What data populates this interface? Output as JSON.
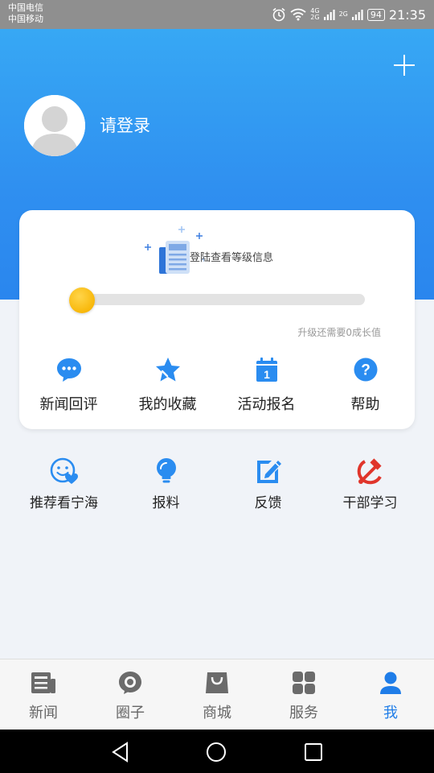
{
  "status_bar": {
    "carrier1": "中国电信",
    "carrier2": "中国移动",
    "net1": "4G",
    "net1b": "2G",
    "net2": "2G",
    "battery": "94",
    "time": "21:35"
  },
  "header": {
    "login_text": "请登录"
  },
  "level_card": {
    "info_text": "登陆查看等级信息",
    "progress": 0,
    "upgrade_text": "升级还需要0成长值",
    "actions": [
      {
        "label": "新闻回评",
        "icon": "chat-bubble-icon"
      },
      {
        "label": "我的收藏",
        "icon": "star-icon"
      },
      {
        "label": "活动报名",
        "icon": "calendar-icon"
      },
      {
        "label": "帮助",
        "icon": "help-icon"
      }
    ]
  },
  "tools": [
    {
      "label": "推荐看宁海",
      "icon": "smile-heart-icon"
    },
    {
      "label": "报料",
      "icon": "lightbulb-icon"
    },
    {
      "label": "反馈",
      "icon": "edit-icon"
    },
    {
      "label": "干部学习",
      "icon": "hammer-sickle-icon"
    }
  ],
  "bottom_nav": {
    "items": [
      {
        "label": "新闻",
        "icon": "news-icon"
      },
      {
        "label": "圈子",
        "icon": "circle-icon"
      },
      {
        "label": "商城",
        "icon": "shopping-bag-icon"
      },
      {
        "label": "服务",
        "icon": "grid-icon"
      },
      {
        "label": "我",
        "icon": "person-icon"
      }
    ],
    "active_index": 4
  },
  "colors": {
    "header_top": "#37a8f4",
    "header_bottom": "#2a86ee",
    "accent": "#1f7de8",
    "icon_blue": "#2a8cf0",
    "knob": "#f8b80b"
  }
}
